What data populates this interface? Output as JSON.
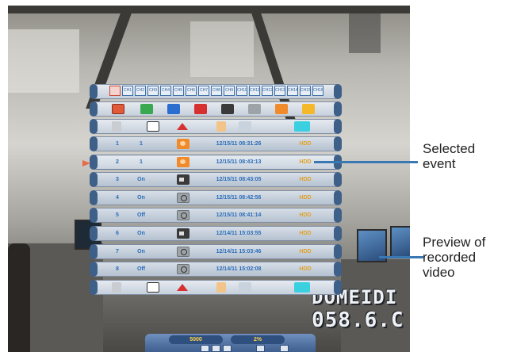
{
  "overlay_text": {
    "camera_name": "DOMEIDI",
    "camera_value": "058.6.C"
  },
  "panel": {
    "channels": [
      "CH1",
      "CH2",
      "CH3",
      "CH4",
      "CH5",
      "CH6",
      "CH7",
      "CH8",
      "CH9",
      "CH10",
      "CH11",
      "CH12",
      "CH13",
      "CH14",
      "CH15",
      "CH16"
    ],
    "events": [
      {
        "index": "1",
        "channel": "1",
        "type": "motion",
        "time": "12/15/11 08:31:26",
        "device": "HDD"
      },
      {
        "index": "2",
        "channel": "1",
        "type": "motion",
        "time": "12/15/11 08:43:13",
        "device": "HDD"
      },
      {
        "index": "3",
        "channel": "On",
        "type": "manual",
        "time": "12/15/11 08:43:05",
        "device": "HDD"
      },
      {
        "index": "4",
        "channel": "On",
        "type": "timer",
        "time": "12/15/11 08:42:56",
        "device": "HDD"
      },
      {
        "index": "5",
        "channel": "Off",
        "type": "timer",
        "time": "12/15/11 08:41:14",
        "device": "HDD"
      },
      {
        "index": "6",
        "channel": "On",
        "type": "manual",
        "time": "12/14/11 15:03:55",
        "device": "HDD"
      },
      {
        "index": "7",
        "channel": "On",
        "type": "timer",
        "time": "12/14/11 15:03:46",
        "device": "HDD"
      },
      {
        "index": "8",
        "channel": "Off",
        "type": "timer",
        "time": "12/14/11 15:02:08",
        "device": "HDD"
      }
    ],
    "selected_index": "2"
  },
  "control_bar": {
    "left_value": "5000",
    "right_value": "2%"
  },
  "callouts": {
    "selected_event": [
      "Selected",
      "event"
    ],
    "preview": [
      "Preview of",
      "recorded",
      "video"
    ]
  },
  "colors": {
    "accent_blue": "#3a78b4",
    "device_text": "#e0a22a",
    "motion": "#f08a2a"
  }
}
